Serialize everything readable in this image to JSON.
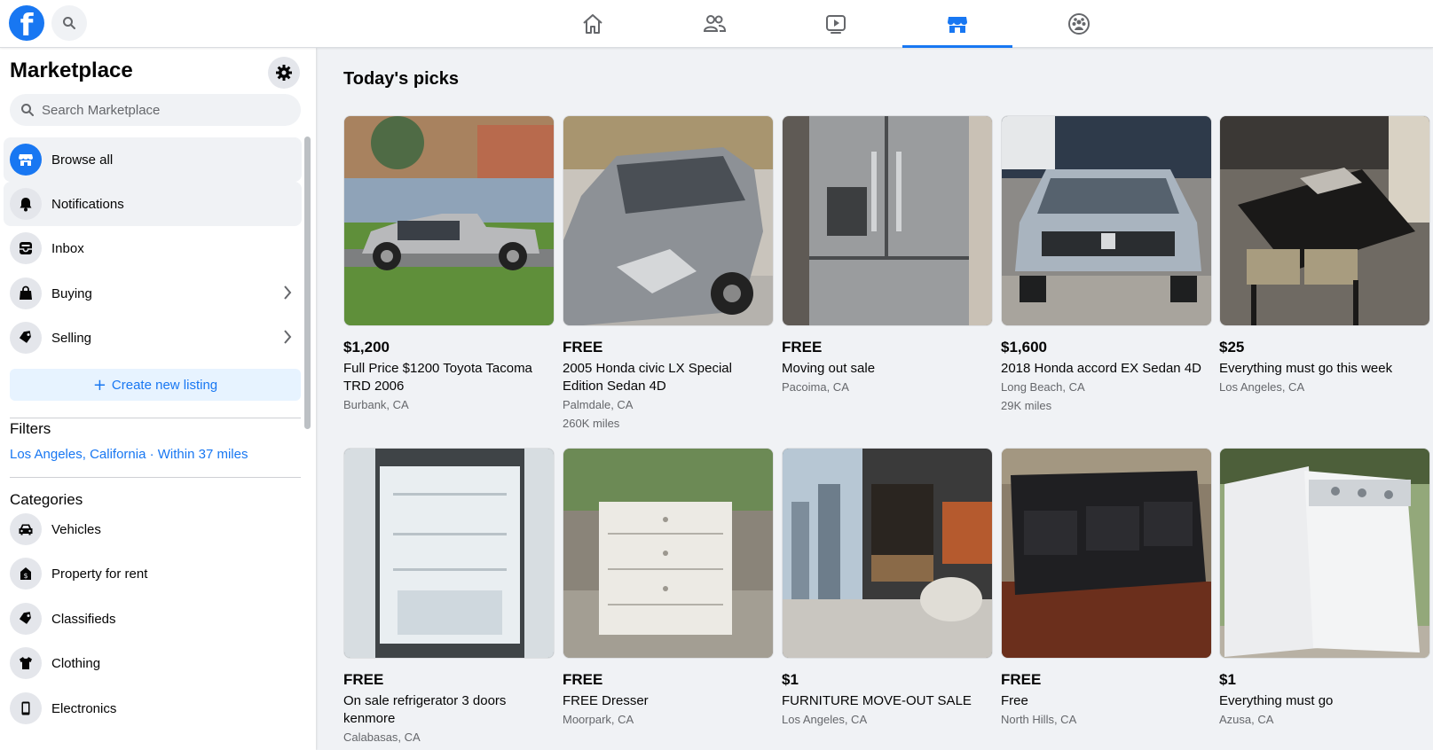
{
  "topbar": {
    "logo_letter": "f",
    "tabs": [
      {
        "icon": "home-icon",
        "active": false
      },
      {
        "icon": "friends-icon",
        "active": false
      },
      {
        "icon": "watch-icon",
        "active": false
      },
      {
        "icon": "marketplace-icon",
        "active": true
      },
      {
        "icon": "groups-icon",
        "active": false
      }
    ],
    "accent": "#1877f2"
  },
  "sidebar": {
    "title": "Marketplace",
    "search_placeholder": "Search Marketplace",
    "items": [
      {
        "label": "Browse all",
        "icon": "storefront-icon"
      },
      {
        "label": "Notifications",
        "icon": "bell-icon"
      },
      {
        "label": "Inbox",
        "icon": "inbox-icon"
      },
      {
        "label": "Buying",
        "icon": "shopping-bag-icon"
      },
      {
        "label": "Selling",
        "icon": "tag-icon"
      }
    ],
    "create_listing": "Create new listing",
    "filters_title": "Filters",
    "filter_location": "Los Angeles, California · Within 37 miles",
    "categories_title": "Categories",
    "categories": [
      {
        "label": "Vehicles",
        "icon": "car-icon"
      },
      {
        "label": "Property for rent",
        "icon": "house-dollar-icon"
      },
      {
        "label": "Classifieds",
        "icon": "tag-icon"
      },
      {
        "label": "Clothing",
        "icon": "shirt-icon"
      },
      {
        "label": "Electronics",
        "icon": "phone-icon"
      }
    ]
  },
  "main": {
    "title": "Today's picks",
    "listings": [
      {
        "price": "$1,200",
        "title": "Full Price $1200 Toyota Tacoma TRD 2006",
        "location": "Burbank, CA",
        "miles": ""
      },
      {
        "price": "FREE",
        "title": "2005 Honda civic LX Special Edition Sedan 4D",
        "location": "Palmdale, CA",
        "miles": "260K miles"
      },
      {
        "price": "FREE",
        "title": "Moving out sale",
        "location": "Pacoima, CA",
        "miles": ""
      },
      {
        "price": "$1,600",
        "title": "2018 Honda accord EX Sedan 4D",
        "location": "Long Beach, CA",
        "miles": "29K miles"
      },
      {
        "price": "$25",
        "title": "Everything must go this week",
        "location": "Los Angeles, CA",
        "miles": ""
      },
      {
        "price": "FREE",
        "title": "On sale refrigerator 3 doors kenmore",
        "location": "Calabasas, CA",
        "miles": ""
      },
      {
        "price": "FREE",
        "title": "FREE Dresser",
        "location": "Moorpark, CA",
        "miles": ""
      },
      {
        "price": "$1",
        "title": "FURNITURE MOVE-OUT SALE",
        "location": "Los Angeles, CA",
        "miles": ""
      },
      {
        "price": "FREE",
        "title": "Free",
        "location": "North Hills, CA",
        "miles": ""
      },
      {
        "price": "$1",
        "title": "Everything must go",
        "location": "Azusa, CA",
        "miles": ""
      }
    ]
  }
}
